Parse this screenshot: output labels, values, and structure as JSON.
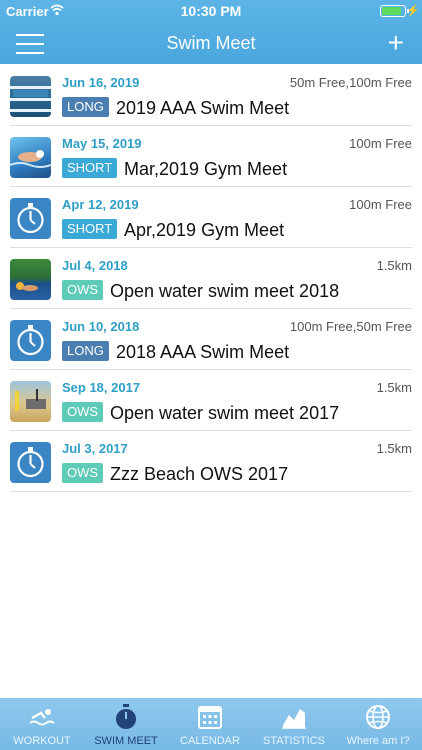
{
  "status_bar": {
    "carrier": "Carrier",
    "time": "10:30 PM"
  },
  "nav": {
    "title": "Swim Meet",
    "add_label": "+"
  },
  "meets": [
    {
      "date": "Jun 16, 2019",
      "distance": "50m Free,100m Free",
      "badge": "LONG",
      "name": "2019 AAA Swim Meet",
      "thumb": "pool-photo"
    },
    {
      "date": "May 15, 2019",
      "distance": "100m Free",
      "badge": "SHORT",
      "name": "Mar,2019 Gym Meet",
      "thumb": "swimmer-photo"
    },
    {
      "date": "Apr 12, 2019",
      "distance": "100m Free",
      "badge": "SHORT",
      "name": "Apr,2019 Gym Meet",
      "thumb": "stopwatch-icon"
    },
    {
      "date": "Jul 4, 2018",
      "distance": "1.5km",
      "badge": "OWS",
      "name": "Open water swim meet 2018",
      "thumb": "open-water-photo"
    },
    {
      "date": "Jun 10, 2018",
      "distance": "100m Free,50m Free",
      "badge": "LONG",
      "name": "2018 AAA Swim Meet",
      "thumb": "stopwatch-icon"
    },
    {
      "date": "Sep 18, 2017",
      "distance": "1.5km",
      "badge": "OWS",
      "name": "Open water swim meet 2017",
      "thumb": "beach-photo"
    },
    {
      "date": "Jul 3, 2017",
      "distance": "1.5km",
      "badge": "OWS",
      "name": "Zzz Beach OWS 2017",
      "thumb": "stopwatch-icon"
    }
  ],
  "tabs": [
    {
      "label": "WORKOUT",
      "icon": "swimmer-icon",
      "active": false
    },
    {
      "label": "SWIM MEET",
      "icon": "stopwatch-icon",
      "active": true
    },
    {
      "label": "CALENDAR",
      "icon": "calendar-icon",
      "active": false
    },
    {
      "label": "STATISTICS",
      "icon": "chart-icon",
      "active": false
    },
    {
      "label": "Where am I?",
      "icon": "globe-icon",
      "active": false
    }
  ],
  "colors": {
    "header": "#4aa6dd",
    "date": "#2f9fc7",
    "long": "#4a7eb0",
    "short": "#3aa9d6",
    "ows": "#5ecbb8",
    "active_tab": "#22427a"
  }
}
